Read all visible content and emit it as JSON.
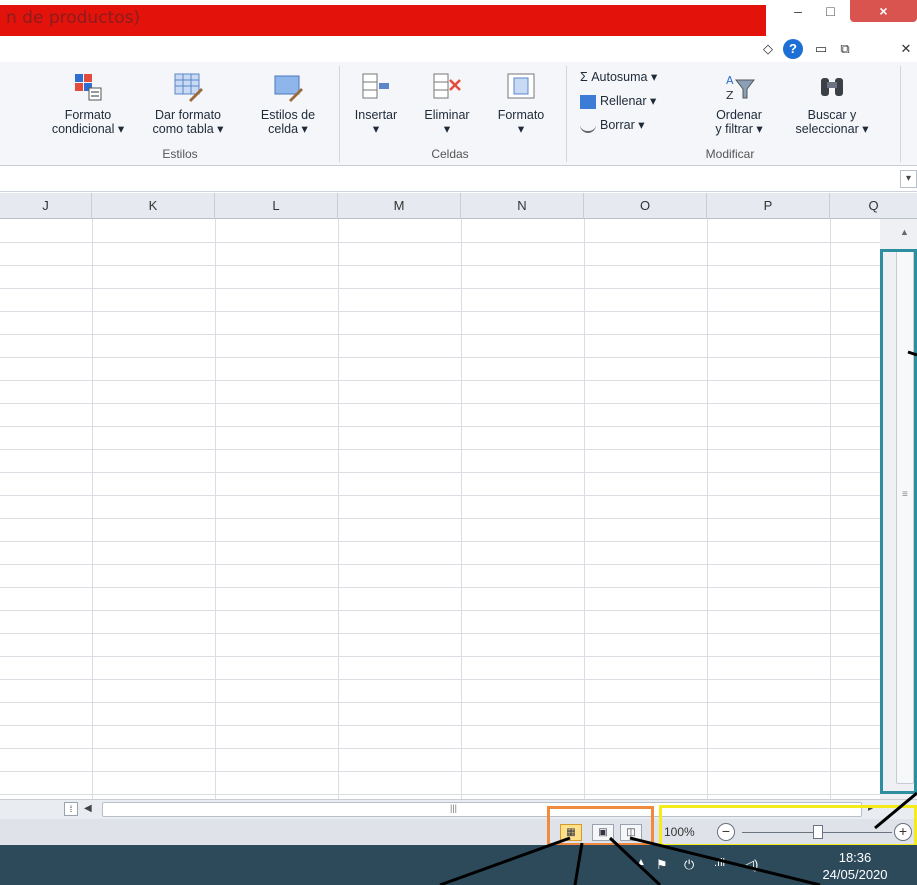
{
  "window": {
    "title": "n de productos)",
    "minimize": "–",
    "maximize": "□",
    "close": "×"
  },
  "helprow": {
    "caret": "◇",
    "help": "?",
    "wmin": "▭",
    "wres": "⧉",
    "wclose": "✕"
  },
  "ribbon": {
    "estilos": {
      "label": "Estilos",
      "buttons": [
        {
          "line1": "Formato",
          "line2": "condicional ▾"
        },
        {
          "line1": "Dar formato",
          "line2": "como tabla ▾"
        },
        {
          "line1": "Estilos de",
          "line2": "celda ▾"
        }
      ]
    },
    "celdas": {
      "label": "Celdas",
      "buttons": [
        {
          "line1": "Insertar",
          "line2": "▾"
        },
        {
          "line1": "Eliminar",
          "line2": "▾"
        },
        {
          "line1": "Formato",
          "line2": "▾"
        }
      ]
    },
    "modificar": {
      "label": "Modificar",
      "autosuma": "Σ Autosuma ▾",
      "rellenar": "Rellenar ▾",
      "borrar": "Borrar ▾",
      "ordenar": {
        "line1": "Ordenar",
        "line2": "y filtrar ▾"
      },
      "buscar": {
        "line1": "Buscar y",
        "line2": "seleccionar ▾"
      }
    }
  },
  "columns": [
    "J",
    "K",
    "L",
    "M",
    "N",
    "O",
    "P",
    "Q"
  ],
  "status": {
    "zoom": "100%",
    "zoom_level_percent": 100,
    "zoom_minus": "−",
    "zoom_plus": "+"
  },
  "taskbar": {
    "time": "18:36",
    "date": "24/05/2020"
  },
  "colors": {
    "title_red": "#e3120b",
    "annot_teal": "#2d8ea0",
    "annot_orange": "#f08a3e",
    "annot_yellow": "#f3ec1a"
  }
}
